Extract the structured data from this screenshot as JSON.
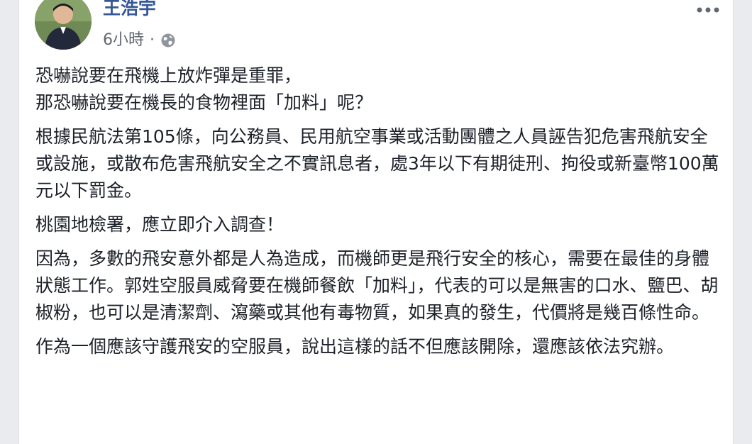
{
  "post": {
    "author": "王浩宇",
    "time": "6小時",
    "separator": "·",
    "privacy_icon": "globe-icon",
    "more_icon": "more-options-icon",
    "paragraphs": [
      "恐嚇說要在飛機上放炸彈是重罪，\n那恐嚇說要在機長的食物裡面「加料」呢？",
      "根據民航法第105條，向公務員、民用航空事業或活動團體之人員誣告犯危害飛航安全或設施，或散布危害飛航安全之不實訊息者，處3年以下有期徒刑、拘役或新臺幣100萬元以下罰金。",
      "桃園地檢署，應立即介入調查！",
      "因為，多數的飛安意外都是人為造成，而機師更是飛行安全的核心，需要在最佳的身體狀態工作。郭姓空服員威脅要在機師餐飲「加料」，代表的可以是無害的口水、鹽巴、胡椒粉，也可以是清潔劑、瀉藥或其他有毒物質，如果真的發生，代價將是幾百條性命。",
      "作為一個應該守護飛安的空服員，說出這樣的話不但應該開除，還應該依法究辦。"
    ]
  },
  "colors": {
    "author_link": "#365899",
    "meta_text": "#616770",
    "body_text": "#1d2129",
    "page_background": "#e9ebee",
    "card_background": "#ffffff"
  }
}
